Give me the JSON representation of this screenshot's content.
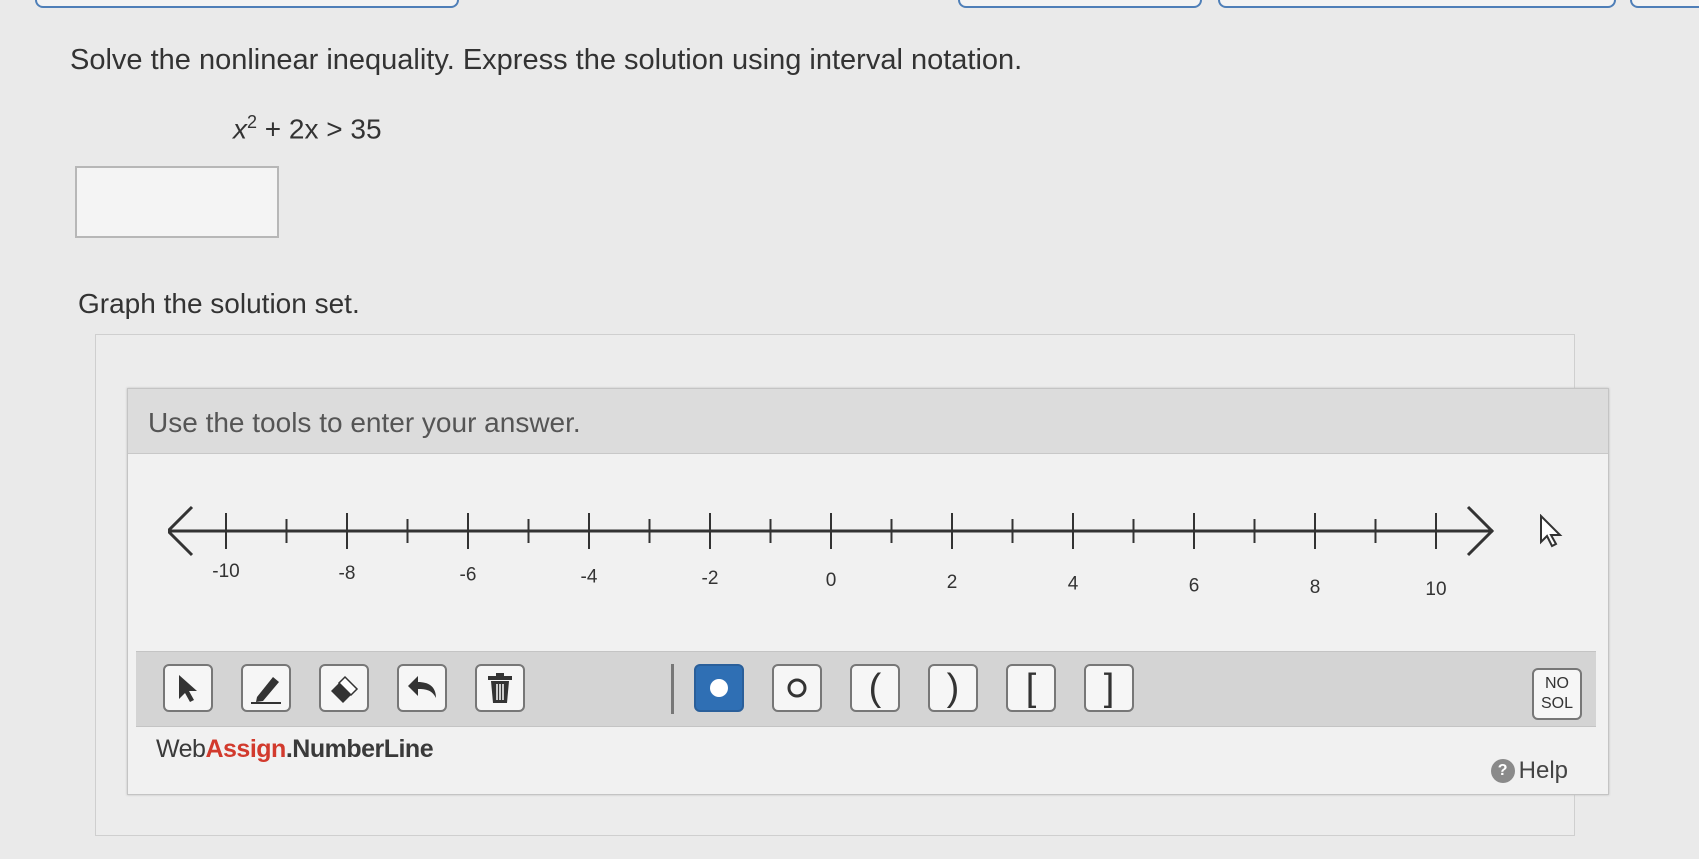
{
  "question": {
    "prompt": "Solve the nonlinear inequality. Express the solution using interval notation.",
    "equation_var": "x",
    "equation_exp": "2",
    "equation_rest": " + 2x > 35",
    "answer_value": ""
  },
  "graph": {
    "label": "Graph the solution set.",
    "tool_header": "Use the tools to enter your answer.",
    "tick_labels": [
      "-10",
      "-8",
      "-6",
      "-4",
      "-2",
      "0",
      "2",
      "4",
      "6",
      "8",
      "10"
    ]
  },
  "toolbar": {
    "tools": [
      {
        "name": "select-tool",
        "icon": "arrow-icon"
      },
      {
        "name": "pencil-tool",
        "icon": "pencil-icon"
      },
      {
        "name": "eraser-tool",
        "icon": "eraser-icon"
      },
      {
        "name": "undo-tool",
        "icon": "undo-icon"
      },
      {
        "name": "delete-tool",
        "icon": "trash-icon"
      },
      {
        "name": "closed-point-tool",
        "icon": "filled-circle-icon"
      },
      {
        "name": "open-point-tool",
        "icon": "open-circle-icon"
      },
      {
        "name": "left-paren-tool",
        "label": "("
      },
      {
        "name": "right-paren-tool",
        "label": ")"
      },
      {
        "name": "left-bracket-tool",
        "label": "["
      },
      {
        "name": "right-bracket-tool",
        "label": "]"
      }
    ],
    "nosol_line1": "NO",
    "nosol_line2": "SOL"
  },
  "footer": {
    "brand_web": "Web",
    "brand_assign": "Assign",
    "brand_rest": ".NumberLine",
    "help_label": "Help"
  },
  "colors": {
    "active_tool": "#2f6fb4",
    "brand_red": "#d23a2d",
    "tab_border": "#4f7fb8"
  }
}
